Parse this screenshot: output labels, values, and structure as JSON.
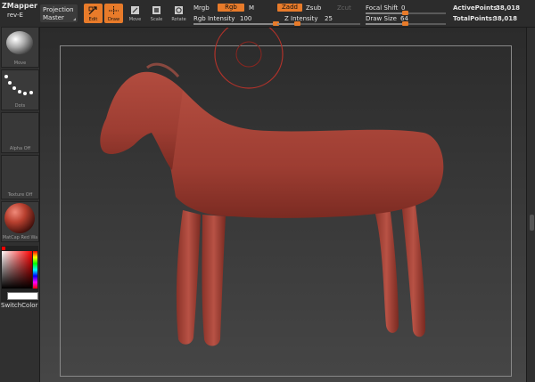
{
  "app": {
    "title": "ZMapper",
    "subtitle": "rev-E"
  },
  "projection_master": {
    "line1": "Projection",
    "line2": "Master"
  },
  "tools": [
    {
      "name": "edit",
      "label": "Edit",
      "active": true
    },
    {
      "name": "draw",
      "label": "Draw",
      "active": true
    },
    {
      "name": "move",
      "label": "Move",
      "active": false
    },
    {
      "name": "scale",
      "label": "Scale",
      "active": false
    },
    {
      "name": "rotate",
      "label": "Rotate",
      "active": false
    }
  ],
  "color_mode": {
    "mrgb": "Mrgb",
    "rgb": "Rgb",
    "m": "M"
  },
  "rgb_intensity": {
    "label": "Rgb Intensity",
    "value": "100",
    "fraction": 1.0
  },
  "z_mode": {
    "zadd": "Zadd",
    "zsub": "Zsub",
    "zcut": "Zcut"
  },
  "z_intensity": {
    "label": "Z Intensity",
    "value": "25",
    "fraction": 0.25
  },
  "focal_shift": {
    "label": "Focal Shift",
    "value": "0",
    "fraction": 0.5
  },
  "draw_size": {
    "label": "Draw Size",
    "value": "64",
    "fraction": 0.5
  },
  "stats": {
    "active_label": "ActivePoints:",
    "active_value": "38,018",
    "total_label": "TotalPoints:",
    "total_value": "38,018"
  },
  "shelf": {
    "move_label": "Move",
    "dots_label": "Dots",
    "alpha_label": "Alpha Off",
    "texture_label": "Texture Off",
    "material_label": "MatCap Red Wa",
    "switch_color_label": "SwitchColor"
  },
  "colors": {
    "accent": "#e87b2a",
    "model": "#a9453a",
    "brush_ring": "#b0322a"
  }
}
